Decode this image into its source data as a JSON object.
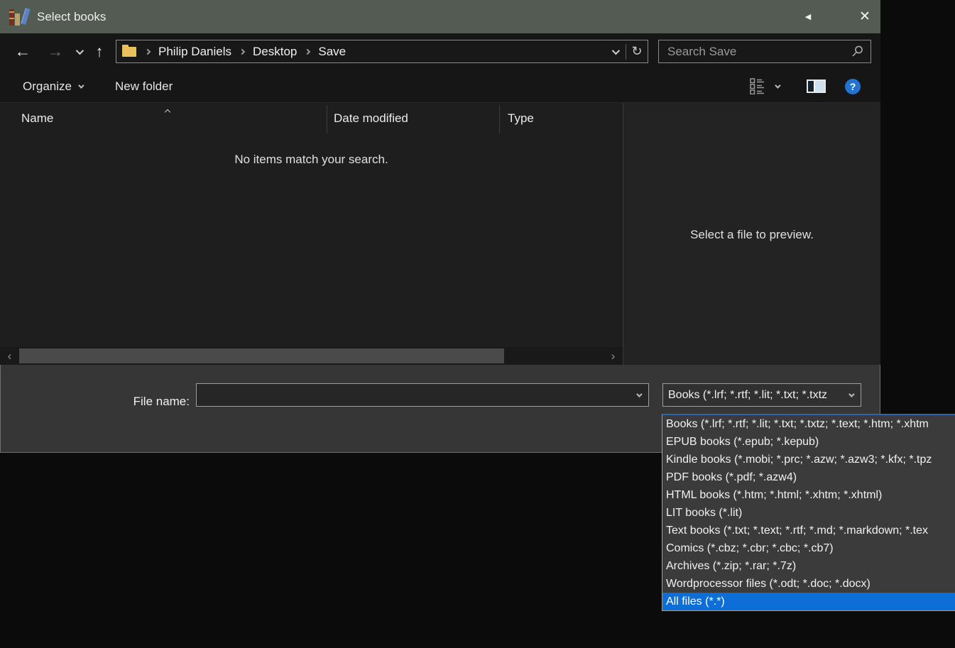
{
  "window": {
    "title": "Select books"
  },
  "icons": {
    "collapse": "◀",
    "close": "✕",
    "back": "←",
    "forward": "→",
    "up": "↑",
    "refresh": "↻",
    "scroll_left": "‹",
    "scroll_right": "›"
  },
  "nav": {
    "breadcrumb": [
      "Philip Daniels",
      "Desktop",
      "Save"
    ],
    "search_placeholder": "Search Save"
  },
  "toolbar": {
    "organize_label": "Organize",
    "new_folder_label": "New folder",
    "help_label": "?"
  },
  "file_list": {
    "columns": [
      "Name",
      "Date modified",
      "Type"
    ],
    "empty_text": "No items match your search."
  },
  "preview": {
    "placeholder_text": "Select a file to preview."
  },
  "footer": {
    "file_name_label": "File name:",
    "file_name_value": "",
    "file_type_value": "Books (*.lrf; *.rtf; *.lit; *.txt; *.txtz"
  },
  "file_type_dropdown": {
    "selected_index": 10,
    "options": [
      "Books (*.lrf; *.rtf; *.lit; *.txt; *.txtz; *.text; *.htm; *.xhtm",
      "EPUB books (*.epub; *.kepub)",
      "Kindle books (*.mobi; *.prc; *.azw; *.azw3; *.kfx; *.tpz",
      "PDF books (*.pdf; *.azw4)",
      "HTML books (*.htm; *.html; *.xhtm; *.xhtml)",
      "LIT books (*.lit)",
      "Text books (*.txt; *.text; *.rtf; *.md; *.markdown; *.tex",
      "Comics (*.cbz; *.cbr; *.cbc; *.cb7)",
      "Archives (*.zip; *.rar; *.7z)",
      "Wordprocessor files (*.odt; *.doc; *.docx)",
      "All files (*.*)"
    ]
  },
  "colors": {
    "titlebar": "#535b52",
    "accent": "#0c6ed6",
    "help_blue": "#2272d0",
    "folder_yellow": "#e9c05c"
  }
}
